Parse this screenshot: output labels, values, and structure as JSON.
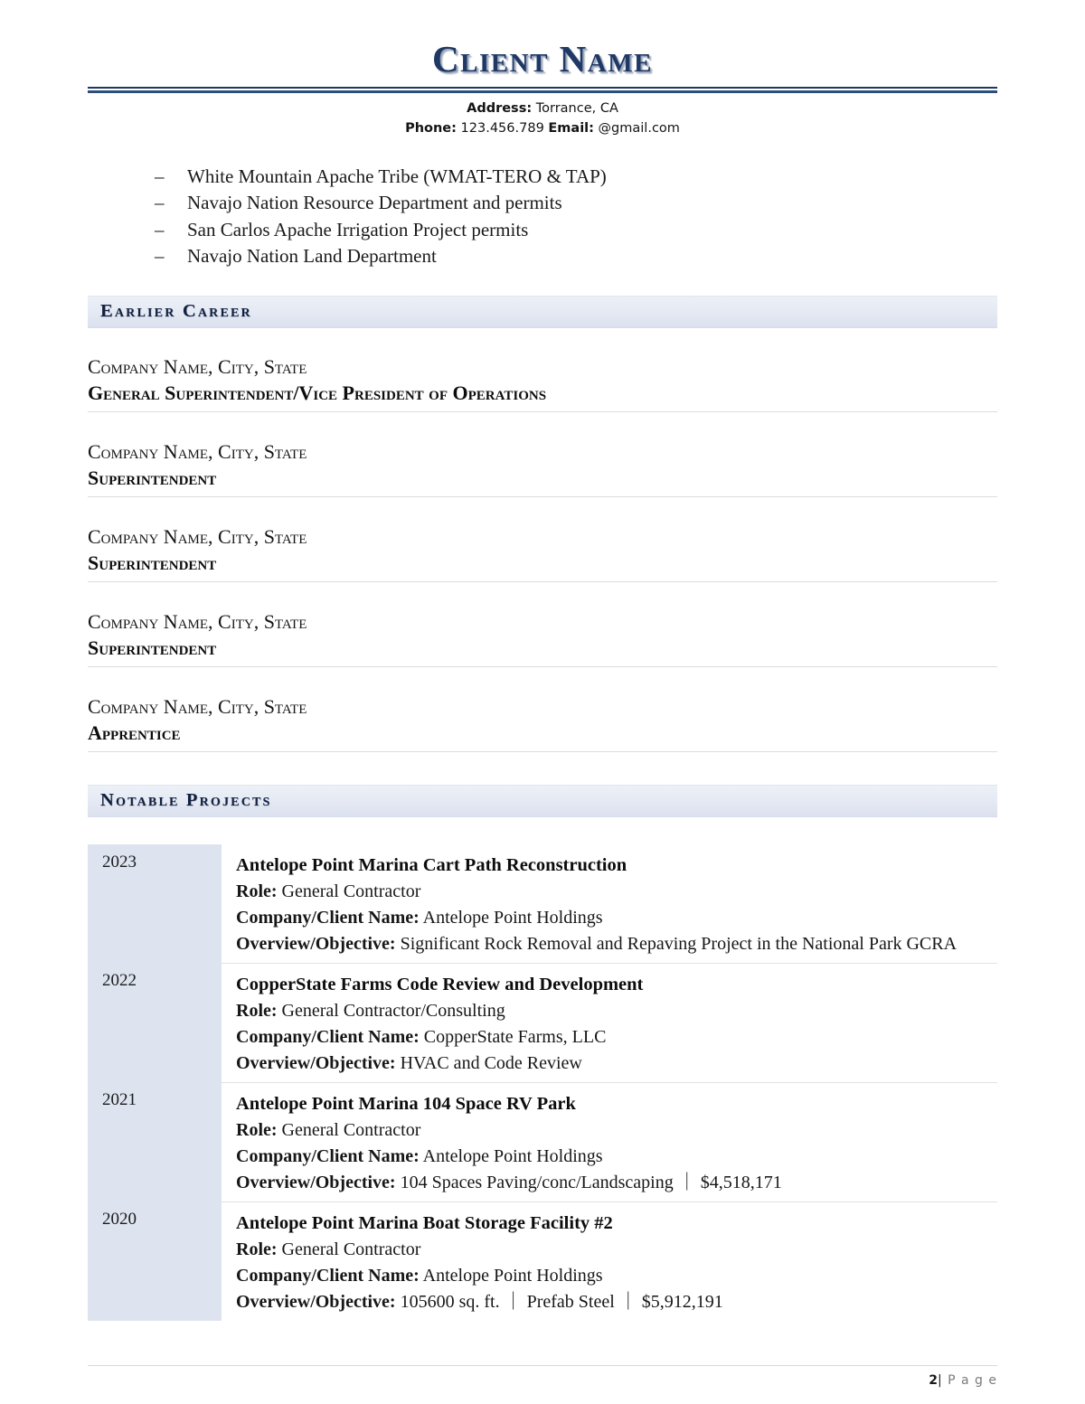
{
  "header": {
    "title": "Client Name",
    "address_label": "Address:",
    "address_value": " Torrance, CA",
    "phone_label": "Phone:",
    "phone_value": " 123.456.789 ",
    "email_label": "Email:",
    "email_value": " @gmail.com"
  },
  "bullets": {
    "marker": "–",
    "items": [
      "White Mountain Apache Tribe (WMAT-TERO & TAP)",
      "Navajo Nation Resource Department and permits",
      "San Carlos Apache Irrigation Project permits",
      "Navajo Nation Land Department"
    ]
  },
  "sections": {
    "earlier_career": "Earlier Career",
    "notable_projects": "Notable Projects"
  },
  "jobs": [
    {
      "company": "Company Name, City, State",
      "role": "General Superintendent/Vice President of Operations"
    },
    {
      "company": "Company Name, City, State",
      "role": "Superintendent"
    },
    {
      "company": "Company Name, City, State",
      "role": "Superintendent"
    },
    {
      "company": "Company Name, City, State",
      "role": "Superintendent"
    },
    {
      "company": "Company Name, City, State",
      "role": "Apprentice"
    }
  ],
  "project_labels": {
    "role": "Role:",
    "client": "Company/Client Name:",
    "overview": "Overview/Objective:"
  },
  "projects": [
    {
      "year": "2023",
      "title": "Antelope Point Marina Cart Path Reconstruction",
      "role": " General Contractor",
      "client": " Antelope Point Holdings",
      "overview": " Significant Rock Removal and Repaving Project in the National Park GCRA"
    },
    {
      "year": "2022",
      "title": "CopperState Farms Code Review and Development",
      "role": " General Contractor/Consulting",
      "client": " CopperState Farms, LLC",
      "overview": " HVAC and Code Review"
    },
    {
      "year": "2021",
      "title": "Antelope Point Marina 104 Space RV Park",
      "role": " General Contractor",
      "client": " Antelope Point Holdings",
      "overview": " 104 Spaces Paving/conc/Landscaping ｜ $4,518,171"
    },
    {
      "year": "2020",
      "title": "Antelope Point Marina Boat Storage Facility #2",
      "role": " General Contractor",
      "client": " Antelope Point Holdings",
      "overview": " 105600 sq. ft. ｜ Prefab Steel ｜ $5,912,191"
    }
  ],
  "footer": {
    "page_number": "2",
    "separator": "|",
    "page_word": "P a g e"
  },
  "colors": {
    "title_navy": "#1f3864",
    "band_blue": "#e4e9f3",
    "year_cell": "#dde3ef"
  }
}
